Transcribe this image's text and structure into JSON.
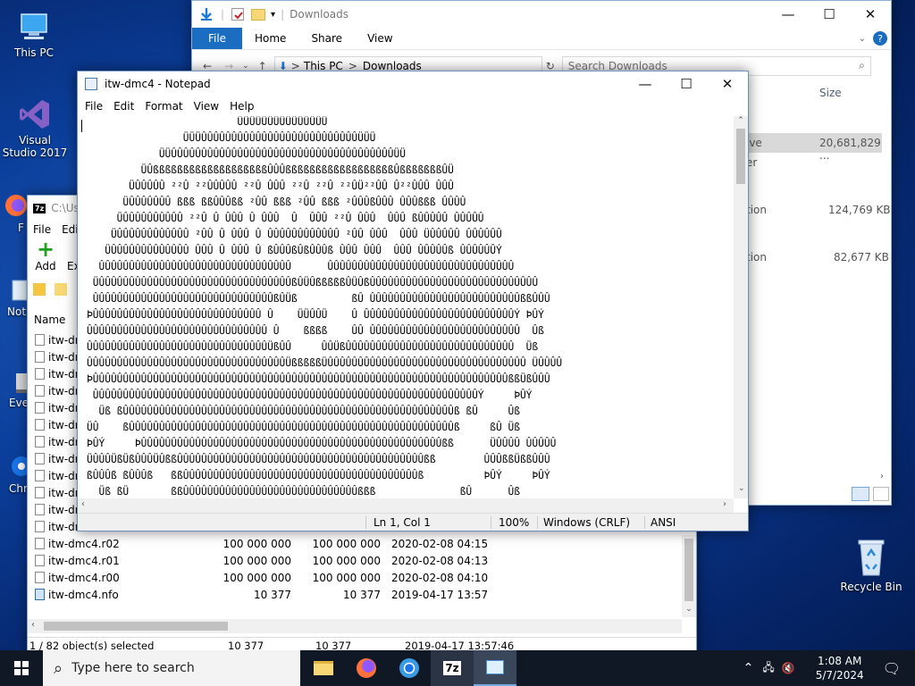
{
  "desktop": {
    "icons": [
      {
        "label": "This PC",
        "icon": "monitor-icon"
      },
      {
        "label": "Visual Studio 2017",
        "icon": "visual-studio-icon"
      },
      {
        "label": "Recycle Bin",
        "icon": "recycle-bin-icon"
      },
      {
        "label": "F",
        "icon": "firefox-icon"
      },
      {
        "label": "Not",
        "icon": "notepad-icon"
      },
      {
        "label": "Eve",
        "icon": "event-icon"
      },
      {
        "label": "Chr",
        "icon": "chrome-icon"
      }
    ]
  },
  "explorer": {
    "title": "Downloads",
    "ribbon_tabs": [
      "File",
      "Home",
      "Share",
      "View"
    ],
    "address": {
      "segment1": "This PC",
      "separator": ">",
      "segment2": "Downloads"
    },
    "search_placeholder": "Search Downloads",
    "column_size": "Size",
    "rows": [
      {
        "label": "ive",
        "size": "20,681,829 ..."
      },
      {
        "label": "er",
        "size": ""
      },
      {
        "label": "tion",
        "size": "124,769 KB"
      },
      {
        "label": "tion",
        "size": "82,677 KB"
      }
    ]
  },
  "sevenzip": {
    "title": "C:\\Us",
    "menu": [
      "File",
      "Edit"
    ],
    "toolbar": {
      "add": "Add",
      "extract": "Ex"
    },
    "column_name": "Name",
    "files_partial": [
      "itw-dr",
      "itw-dr",
      "itw-dr",
      "itw-dr",
      "itw-dr",
      "itw-dr",
      "itw-dr",
      "itw-dr",
      "itw-dr",
      "itw-dr",
      "itw-dr",
      "itw-dr"
    ],
    "files": [
      {
        "name": "itw-dmc4.r02",
        "size": "100 000 000",
        "packed": "100 000 000",
        "modified": "2020-02-08 04:15"
      },
      {
        "name": "itw-dmc4.r01",
        "size": "100 000 000",
        "packed": "100 000 000",
        "modified": "2020-02-08 04:13"
      },
      {
        "name": "itw-dmc4.r00",
        "size": "100 000 000",
        "packed": "100 000 000",
        "modified": "2020-02-08 04:10"
      },
      {
        "name": "itw-dmc4.nfo",
        "size": "10 377",
        "packed": "10 377",
        "modified": "2019-04-17 13:57"
      }
    ],
    "status": {
      "selected": "1 / 82 object(s) selected",
      "size": "10 377",
      "packed": "10 377",
      "modified": "2019-04-17 13:57:46"
    }
  },
  "notepad": {
    "title": "itw-dmc4 - Notepad",
    "menu": [
      "File",
      "Edit",
      "Format",
      "View",
      "Help"
    ],
    "lines": [
      "                         ÜÜÜÜÜÜÜÜÜÜÜÜÜÜÜ",
      "                ÜÜÜÛÛÛÛÛÛÛÛÛÛÛÛÛÛÛÛÛÛÛÛÛÛÛÛÛÛÜÜÜ",
      "            ÜÜÛÛÛÛÛÛÛÛÛÛÛÛÛÛÛÛÛÛÛÛÛÛÛÛÛÛÛÛÛÛÛÛÛÛÛÛÛÜÜ",
      "         ÜÛßßßßßßßßßßßßßßßßßßßÛÛÛßßßßßßßßßßßßßßßßßßÛßßßßßßßÛÜ",
      "       ÜÛÛÛÛÛ ²²Û ²²ÛÛÛÛÛ ²²Û ÛÛÛ ²²Û ²²Û ²²ÛÜ²²ÛÛ Û²²ÛÛÛ ÛÛÛ",
      "      ÜÛÛÛÛÛÛÛ ßßß ßßÛÛÛßß ²ÛÛ ßßß ²ÛÛ ßßß ²ÛÛÛßÛÛÛ ÛÛÛßßß ÛÛÛÛ",
      "     ÜÛÛÛÛÛÛÛÛÛÛ ²²Û Û ÛÛÛ Û ÛÛÛ  Û  ÛÛÛ ²²Û ÛÛÛ  ÛÛÛ ßÛÛÛÛÛ ÛÛÛÛÛ",
      "    ÜÛÛÛÛÛÛÛÛÛÛÛÛ ²ÛÛ Û ÛÛÛ Û ÛÛÛÛÛÛÛÛÛÛÛÛ ²ÛÛ ÛÛÛ  ÛÛÛ ÜÛÛÛÛÛ ÛÛÛÛÛÛ",
      "   ÜÛÛÛÛÛÛÛÛÛÛÛÛÛ ÛÛÛ Û ÛÛÛ Û ßÛÛÛßÛßÛÛÛß ÛÛÛ ÛÛÛ  ÛÛÛ ÛÛÛÛÛß ÛÛÛÛÛÛÝ",
      "  ÛÛÛÛÛÛÛÛÛÛÛÛÛÛÛÛÛÛÛÛÛÛÛÛÛÛÛÛÛÛÛÛ      ÛÛÛÛÛÛÛÛÛÛÛÛÛÛÛÛÛÛÛÛÛÛÛÛÛÛÛÛÛÛÛ",
      " ÜÛÛÛÛÛÛÛÛÛÛÛÛÛÛÛÛÛÛÛÛÛÛÛÛÛÛÛÛÛÛÛÛßÛÜÛßßßßßÛÜÛßÛÛÛÛÛÛÛÛÛÛÛÛÛÛÛÛÛÛÛÛÛÛÛÛÛÛÛÛ",
      " ÛÛÛÛÛÛÛÛÛÛÛÛÛÛÛÛÛÛÛÛÛÛÛÛÛÛÛÛÛÛßÛÜß         ßÛ ÛÛÛÛÛÛÛÛÛÛÛÛÛÛÛÛÛÛÛÛÛÛÛÛÛßßÛÛÛ",
      "ÞÛÛÛÛÛÛÛÛÛÛÛÛÛÛÛÛÛÛÛÛÛÛÛÛÛÛÛÛ Û    ÜÜÛÛÜ    Û ÛÛÛÛÛÛÛÛÛÛÛÛÛÛÛÛÛÛÛÛÛÛÛÛÛÝ ÞÛÝ",
      "ÛÛÛÛÛÛÛÛÛÛÛÛÛÛÛÛÛÛÛÛÛÛÛÛÛÛÛÛÛÛ Û    ßßßß    ÛÛ ÛÛÛÛÛÛÛÛÛÛÛÛÛÛÛÛÛÛÛÛÛÛÛÛÛ  Ûß",
      "ÛÛÛÛÛÛÛÛÛÛÛÛÛÛÛÛÛÛÛÛÛÛÛÛÛÛÛÛÛÛÜßÛÛ     ÛÛÜßÛÛÛÛÛÛÛÛÛÛÛÛÛÛÛÛÛÛÛÛÛÛÛÛÛÛÛÛ  Üß",
      "ÛÛÛÛÛÛÛÛÛÛÛÛÛÛÛÛÛÛÛÛÛÛÛÛÛÛÛÛÛÛÛÛÛÜßßßßßÜÛÛÛÛÛÛÛÛÛÛÛÛÛÛÛÛÛÛÛÛÛÛÛÛÛÛÛÛÛÛÛÛÛ ÜÛÛÛÛ",
      "ÞÛÛÛÛÛÛÛÛÛÛÛÛÛÛÛÛÛÛÛÛÛÛÛÛÛÛÛÛÛÛÛÛÛÛÛÛÛÛÛÛÛÛÛÛÛÛÛÛÛÛÛÛÛÛÛÛÛÛÛÛÛÛÛÛÛÛÛÛÛßßÜßÛÛÛ",
      " ÛÛÛÛÛÛÛÛÛÛÛÛÛÛÛÛÛÛÛÛÛÛÛÛÛÛÛÛÛÛÛÛÛÛÛÛÛÛÛÛÛÛÛÛÛÛÛÛÛÛÛÛÛÛÛÛÛÛÛÛÛÛÛÛÝ     ÞÛÝ",
      "  Üß ßÛÛÛÛÛÛÛÛÛÛÛÛÛÛÛÛÛÛÛÛÛÛÛÛÛÛÛÛÛÛÛÛÛÛÛÛÛÛÛÛÛÛÛÛÛÛÛÛÛÛÛÛÛÛÛß ßÛ     Ûß",
      "ÜÛ    ßÛÛÛÛÛÛÛÛÛÛÛÛÛÛÛÛÛÛÛÛÛÛÛÛÛÛÛÛÛÛÛÛÛÛÛÛÛÛÛÛÛÛÛÛÛÛÛÛÛÛÛÛÛÛß     ßÛ Üß",
      "ÞÛÝ     ÞÛÛÛÛÛÛÛÛÛÛÛÛÛÛÛÛÛÛÛÛÛÛÛÛÛÛÛÛÛÛÛÛÛÛÛÛÛÛÛÛÛÛÛÛÛÛÛÛÛÛßß      ÜÛÛÛÛ ÛÛÛÛÛ",
      "ÜÛÛÛÜßÜßÛÛÛÜÛßßÛÛÛÛÛÛÛÛÛÛÛÛÛÛÛÛÛÛÛÛÛÛÛÛÛÛÛÛÛÛÛÛÛÛÛÛÛÛÛÛÛßß        ÛÛÛßßÜßßÛÛÛ",
      "ßÛÛÛß ßÛÛÛß   ßßÛÛÛÛÛÛÛÛÛÛÛÛÛÛÛÛÛÛÛÛÛÛÛÛÛÛÛÛÛÛÛÛÛÛÛÛÛÛÛß          ÞÛÝ     ÞÛÝ",
      "  Üß ßÜ       ßßÛÛÛÛÛÛÛÛÛÛÛÛÛÛÛÛÛÛÛÛÛÛÛÛÛÛÛÛÛßßß              ßÛ      Ûß"
    ],
    "status": {
      "position": "Ln 1, Col 1",
      "zoom": "100%",
      "line_ending": "Windows (CRLF)",
      "encoding": "ANSI"
    }
  },
  "taskbar": {
    "search_placeholder": "Type here to search",
    "time": "1:08 AM",
    "date": "5/7/2024"
  }
}
